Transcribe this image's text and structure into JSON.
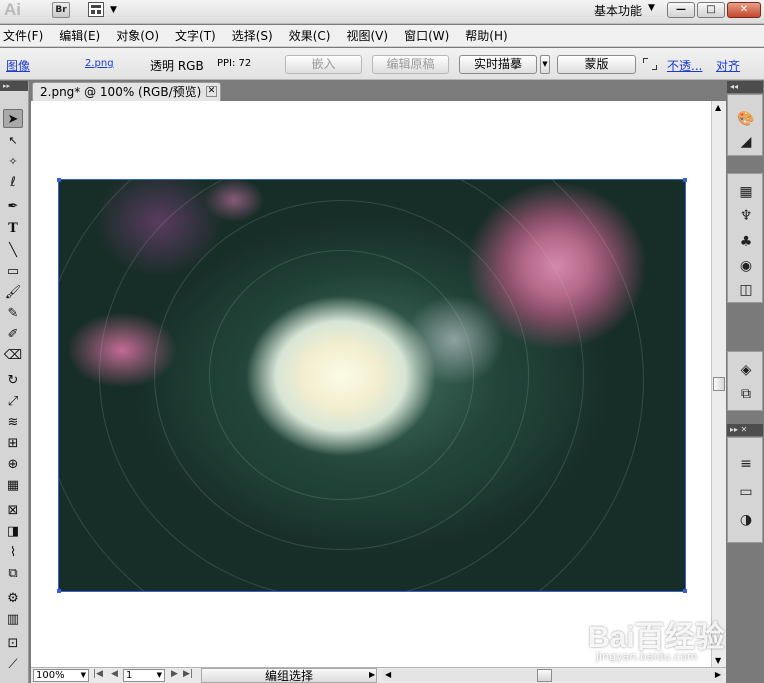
{
  "app": {
    "logo": "Ai",
    "bridge_label": "Br",
    "workspace": "基本功能",
    "window_buttons": [
      "—",
      "□",
      "✕"
    ]
  },
  "menu": [
    "文件(F)",
    "编辑(E)",
    "对象(O)",
    "文字(T)",
    "选择(S)",
    "效果(C)",
    "视图(V)",
    "窗口(W)",
    "帮助(H)"
  ],
  "control": {
    "type": "图像",
    "filename": "2.png",
    "mode": "透明 RGB",
    "ppi": "PPI: 72",
    "embed": "嵌入",
    "edit_original": "编辑原稿",
    "live_trace": "实时描摹",
    "mask": "蒙版",
    "opacity": "不透...",
    "align": "对齐"
  },
  "document": {
    "tab_title": "2.png* @ 100% (RGB/预览)",
    "tab_close": "✕"
  },
  "status": {
    "zoom": "100%",
    "page": "1",
    "text": "编组选择"
  },
  "watermark": {
    "brand": "Bai百经验",
    "url": "jingyan.baidu.com"
  },
  "colors": {
    "selection": "#3a61d0",
    "panel_bg": "#d5d5d5",
    "pasteboard": "#7a7a7a"
  }
}
